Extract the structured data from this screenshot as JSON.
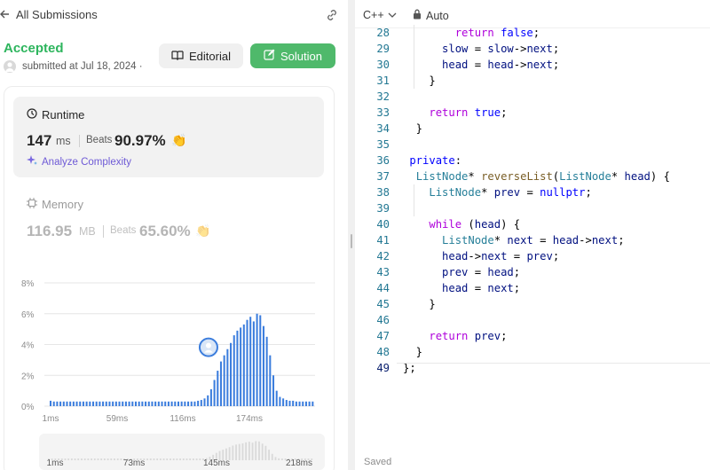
{
  "header": {
    "back_label": "All Submissions"
  },
  "result": {
    "status": "Accepted",
    "submitted": "submitted at Jul 18, 2024 ·",
    "editorial_label": "Editorial",
    "solution_label": "Solution",
    "accent_color": "#2db55d"
  },
  "runtime": {
    "title": "Runtime",
    "value": "147",
    "unit": "ms",
    "beats_label": "Beats",
    "beats_value": "90.97%",
    "analyze_label": "Analyze Complexity"
  },
  "memory": {
    "title": "Memory",
    "value": "116.95",
    "unit": "MB",
    "beats_label": "Beats",
    "beats_value": "65.60%"
  },
  "chart_data": {
    "type": "bar",
    "y_ticks": [
      "8%",
      "6%",
      "4%",
      "2%",
      "0%"
    ],
    "x_ticks": [
      "1ms",
      "59ms",
      "116ms",
      "174ms"
    ],
    "ylim": [
      0,
      8
    ],
    "grid": true,
    "bar_color": "#3b7ddd",
    "values": [
      0.35,
      0.3,
      0.3,
      0.3,
      0.3,
      0.3,
      0.3,
      0.3,
      0.3,
      0.3,
      0.3,
      0.3,
      0.3,
      0.3,
      0.3,
      0.3,
      0.3,
      0.3,
      0.3,
      0.3,
      0.3,
      0.3,
      0.3,
      0.3,
      0.3,
      0.3,
      0.3,
      0.3,
      0.3,
      0.3,
      0.3,
      0.3,
      0.3,
      0.3,
      0.3,
      0.3,
      0.3,
      0.3,
      0.3,
      0.3,
      0.3,
      0.3,
      0.3,
      0.3,
      0.3,
      0.35,
      0.4,
      0.5,
      0.7,
      1.1,
      1.7,
      2.3,
      2.9,
      3.3,
      3.7,
      4.1,
      4.6,
      4.9,
      5.1,
      5.3,
      5.6,
      5.8,
      5.5,
      6.0,
      5.9,
      5.2,
      4.5,
      3.3,
      2.0,
      1.0,
      0.6,
      0.5,
      0.4,
      0.35,
      0.35,
      0.3,
      0.3,
      0.3,
      0.3,
      0.3,
      0.3
    ],
    "highlight_index": 52
  },
  "mini_chart": {
    "x_ticks": [
      "1ms",
      "73ms",
      "145ms",
      "218ms"
    ]
  },
  "editor": {
    "language": "C++",
    "mode": "Auto",
    "status": "Saved",
    "lines": [
      {
        "n": "28",
        "html": "<span class=\"kw\">        return</span> <span class=\"kb\">false</span>;"
      },
      {
        "n": "29",
        "html": "      <span class=\"vr\">slow</span> = <span class=\"vr\">slow</span>-&gt;<span class=\"vr\">next</span>;"
      },
      {
        "n": "30",
        "html": "      <span class=\"vr\">head</span> = <span class=\"vr\">head</span>-&gt;<span class=\"vr\">next</span>;"
      },
      {
        "n": "31",
        "html": "    }"
      },
      {
        "n": "32",
        "html": ""
      },
      {
        "n": "33",
        "html": "    <span class=\"kw\">return</span> <span class=\"kb\">true</span>;"
      },
      {
        "n": "34",
        "html": "  }"
      },
      {
        "n": "35",
        "html": ""
      },
      {
        "n": "36",
        "html": " <span class=\"kb\">private</span>:"
      },
      {
        "n": "37",
        "html": "  <span class=\"ty\">ListNode</span>* <span class=\"fn\">reverseList</span>(<span class=\"ty\">ListNode</span>* <span class=\"vr\">head</span>) {"
      },
      {
        "n": "38",
        "html": "    <span class=\"ty\">ListNode</span>* <span class=\"vr\">prev</span> = <span class=\"kb\">nullptr</span>;"
      },
      {
        "n": "39",
        "html": ""
      },
      {
        "n": "40",
        "html": "    <span class=\"kw\">while</span> (<span class=\"vr\">head</span>) {"
      },
      {
        "n": "41",
        "html": "      <span class=\"ty\">ListNode</span>* <span class=\"vr\">next</span> = <span class=\"vr\">head</span>-&gt;<span class=\"vr\">next</span>;"
      },
      {
        "n": "42",
        "html": "      <span class=\"vr\">head</span>-&gt;<span class=\"vr\">next</span> = <span class=\"vr\">prev</span>;"
      },
      {
        "n": "43",
        "html": "      <span class=\"vr\">prev</span> = <span class=\"vr\">head</span>;"
      },
      {
        "n": "44",
        "html": "      <span class=\"vr\">head</span> = <span class=\"vr\">next</span>;"
      },
      {
        "n": "45",
        "html": "    }"
      },
      {
        "n": "46",
        "html": ""
      },
      {
        "n": "47",
        "html": "    <span class=\"kw\">return</span> <span class=\"vr\">prev</span>;"
      },
      {
        "n": "48",
        "html": "  }"
      },
      {
        "n": "49",
        "html": "};"
      }
    ]
  },
  "icons": {
    "back": "arrow-left-icon",
    "link": "link-icon",
    "editorial": "book-icon",
    "solution": "edit-icon",
    "runtime": "clock-icon",
    "memory": "chip-icon",
    "analyze": "sparkle-icon",
    "lock": "lock-icon",
    "chevron": "chevron-down-icon"
  }
}
